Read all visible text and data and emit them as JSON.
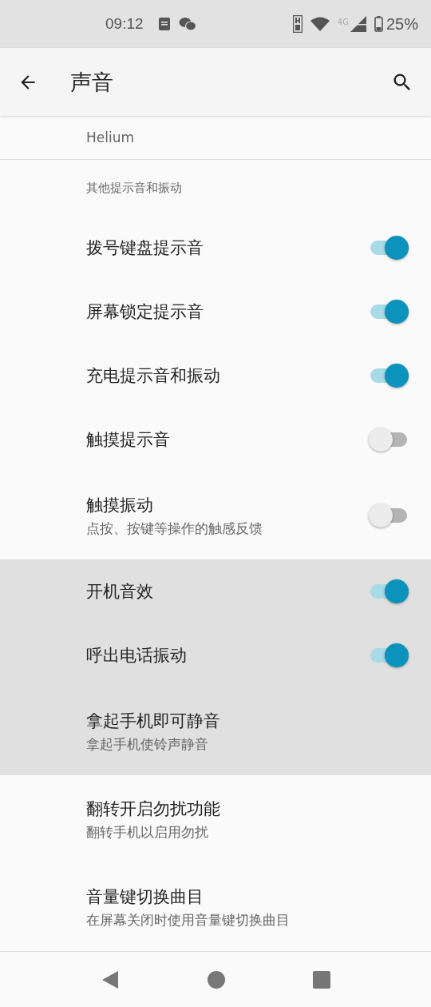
{
  "status_bar": {
    "time": "09:12",
    "network": "4G",
    "battery": "25%"
  },
  "app_bar": {
    "title": "声音"
  },
  "previous_item": {
    "summary": "Helium"
  },
  "section": {
    "header": "其他提示音和振动",
    "rows": [
      {
        "title": "拨号键盘提示音",
        "kind": "switch",
        "on": true,
        "highlighted": false
      },
      {
        "title": "屏幕锁定提示音",
        "kind": "switch",
        "on": true,
        "highlighted": false
      },
      {
        "title": "充电提示音和振动",
        "kind": "switch",
        "on": true,
        "highlighted": false
      },
      {
        "title": "触摸提示音",
        "kind": "switch",
        "on": false,
        "highlighted": false
      },
      {
        "title": "触摸振动",
        "summary": "点按、按键等操作的触感反馈",
        "kind": "switch",
        "on": false,
        "highlighted": false
      },
      {
        "title": "开机音效",
        "kind": "switch",
        "on": true,
        "highlighted": true
      },
      {
        "title": "呼出电话振动",
        "kind": "switch",
        "on": true,
        "highlighted": true
      },
      {
        "title": "拿起手机即可静音",
        "summary": "拿起手机使铃声静音",
        "kind": "text",
        "highlighted": true
      },
      {
        "title": "翻转开启勿扰功能",
        "summary": "翻转手机以启用勿扰",
        "kind": "text",
        "highlighted": false
      },
      {
        "title": "音量键切换曲目",
        "summary": "在屏幕关闭时使用音量键切换曲目",
        "kind": "text",
        "highlighted": false
      }
    ]
  }
}
